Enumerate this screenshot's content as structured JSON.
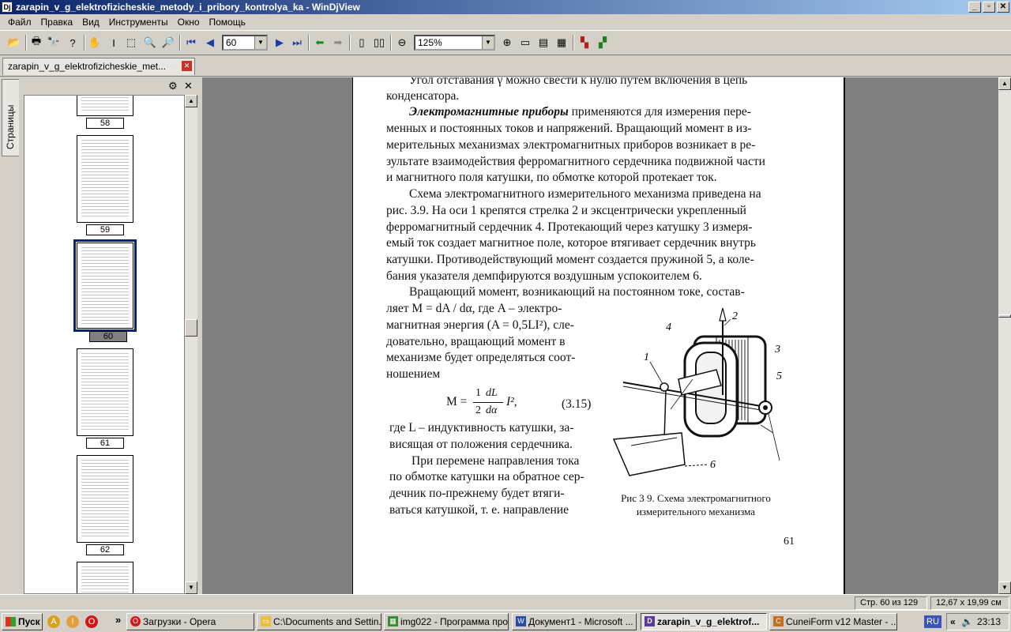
{
  "window": {
    "title": "zarapin_v_g_elektrofizicheskie_metody_i_pribory_kontrolya_ka - WinDjView",
    "app_icon": "Dj",
    "minimize": "_",
    "restore": "▫",
    "close": "✕"
  },
  "menu": [
    "Файл",
    "Правка",
    "Вид",
    "Инструменты",
    "Окно",
    "Помощь"
  ],
  "toolbar": {
    "page_value": "60",
    "zoom_value": "125%"
  },
  "tab": {
    "label": "zarapin_v_g_elektrofizicheskie_met...",
    "close": "✕"
  },
  "sidebar": {
    "vertical_tab": "Страницы",
    "gear": "⚙",
    "close": "✕",
    "thumbnails": [
      "58",
      "59",
      "60",
      "61",
      "62"
    ],
    "selected_page": "60"
  },
  "page": {
    "lines": [
      "Угол отставания γ можно свести к нулю путем включения в цепь",
      "конденсатора.",
      "Электромагнитные приборы применяются для измерения пере-",
      "менных и постоянных токов и напряжений. Вращающий момент в из-",
      "мерительных механизмах электромагнитных приборов возникает в ре-",
      "зультате взаимодействия ферромагнитного сердечника подвижной части",
      "и магнитного поля катушки, по обмотке которой протекает ток.",
      "Схема электромагнитного измерительного механизма приведена на",
      "рис. 3.9. На оси 1 крепятся стрелка 2 и эксцентрически укрепленный",
      "ферромагнитный сердечник 4. Протекающий через катушку 3 измеря-",
      "емый ток создает магнитное поле, которое втягивает сердечник внутрь",
      "катушки. Противодействующий момент создается пружиной 5, а коле-",
      "бания указателя демпфируются воздушным успокоителем 6.",
      "Вращающий момент, возникающий на постоянном токе, состав-"
    ],
    "col_lines": [
      "ляет M = dA / dα, где A – электро-",
      "магнитная энергия (A = 0,5LI²), сле-",
      "довательно, вращающий момент в",
      "механизме будет определяться соот-",
      "ношением"
    ],
    "formula": {
      "lhs": "M =",
      "num": "1",
      "den": "2",
      "dnum": "dL",
      "dden": "dα",
      "rhs": "I², ",
      "number": "(3.15)"
    },
    "after_lines": [
      "где L – индуктивность катушки, за-",
      "висящая от положения сердечника.",
      "При перемене направления тока",
      "по обмотке катушки на обратное сер-",
      "дечник по-прежнему будет втяги-",
      "ваться катушкой, т. е. направление"
    ],
    "figure_labels": [
      "1",
      "2",
      "3",
      "4",
      "5",
      "6"
    ],
    "caption_line1": "Рис  3 9. Схема электромагнитного",
    "caption_line2": "измерительного механизма",
    "page_number": "61"
  },
  "status": {
    "page_info": "Стр. 60 из 129",
    "size_info": "12,67 x 19,99 см"
  },
  "taskbar": {
    "start": "Пуск",
    "tasks": [
      "Загрузки - Opera",
      "C:\\Documents and Settin...",
      "img022 - Программа про...",
      "Документ1 - Microsoft ...",
      "zarapin_v_g_elektrof...",
      "CuneiForm v12 Master - ..."
    ],
    "lang": "RU",
    "time": "23:13",
    "more": "»"
  }
}
